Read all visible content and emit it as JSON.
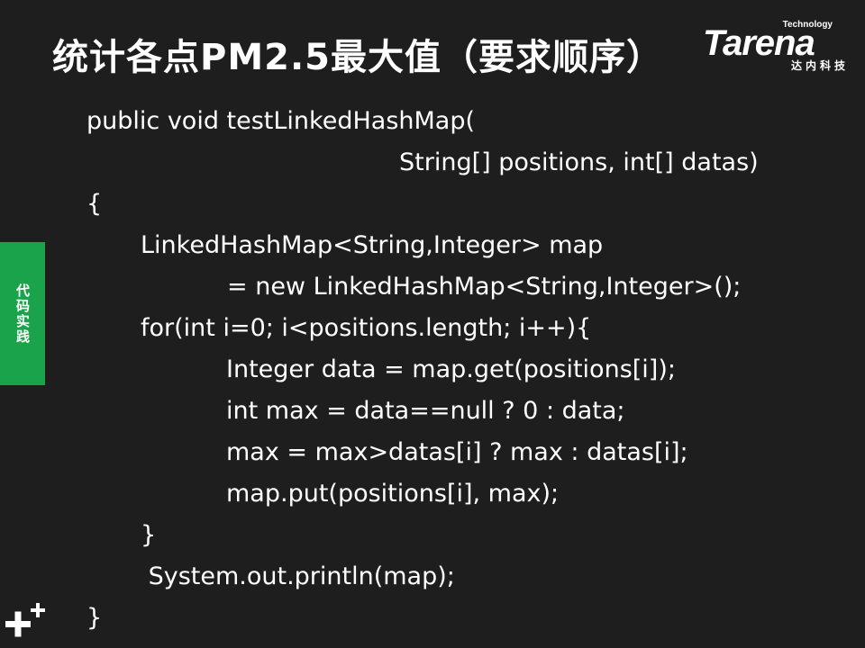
{
  "slide": {
    "title": "统计各点PM2.5最大值（要求顺序）",
    "logo": {
      "name": "Tarena",
      "tagline": "Technology",
      "cn_text": "达内科技"
    },
    "side_tab": {
      "label": "代码实践",
      "color": "#1aa34a"
    },
    "code_lines": [
      "public void testLinkedHashMap(",
      "String[] positions, int[] datas)",
      "{",
      "LinkedHashMap<String,Integer> map",
      "= new LinkedHashMap<String,Integer>();",
      "for(int i=0; i<positions.length; i++){",
      "Integer data = map.get(positions[i]);",
      "int max = data==null ? 0 : data;",
      "max = max>datas[i] ? max : datas[i];",
      "map.put(positions[i], max);",
      "}",
      " System.out.println(map);",
      "}"
    ],
    "decor_icon": "plus-icon",
    "background_color": "#1e1e1e",
    "text_color": "#ffffff"
  }
}
